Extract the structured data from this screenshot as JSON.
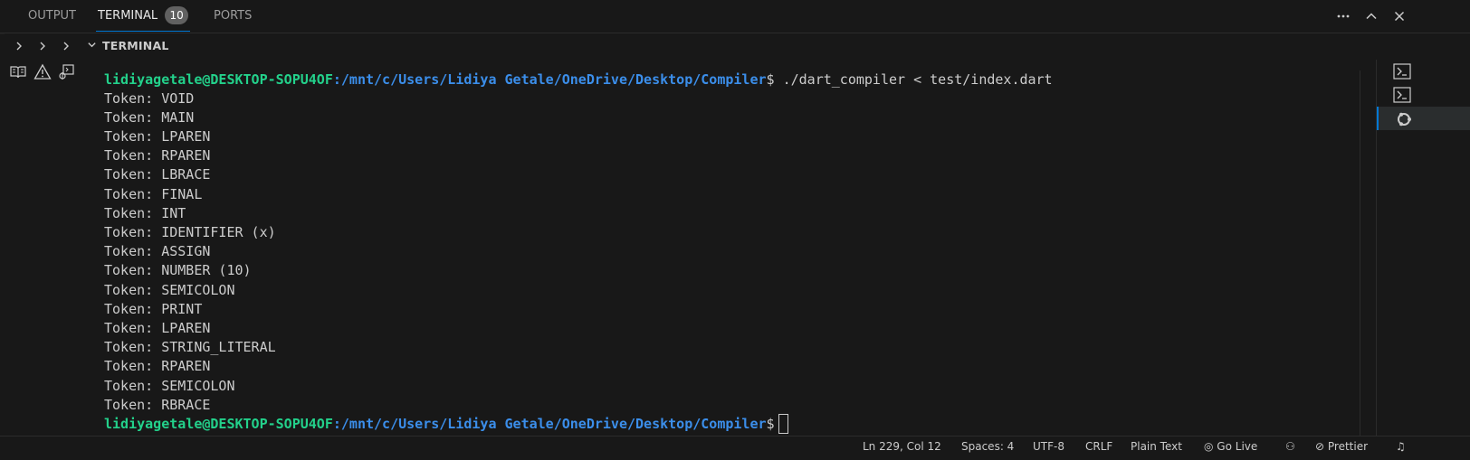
{
  "panel": {
    "tabs": [
      {
        "label": "OUTPUT"
      },
      {
        "label": "TERMINAL",
        "badge": "10"
      },
      {
        "label": "PORTS"
      }
    ],
    "actions": [
      "more-actions-icon",
      "maximize-panel-icon",
      "close-panel-icon"
    ]
  },
  "section": {
    "title": "TERMINAL"
  },
  "terminal": {
    "prompt": {
      "user": "lidiyagetale@DESKTOP-SOPU4OF",
      "path": ":/mnt/c/Users/Lidiya Getale/OneDrive/Desktop/Compiler",
      "dollar": "$"
    },
    "command": " ./dart_compiler < test/index.dart",
    "output": [
      "Token: VOID",
      "Token: MAIN",
      "Token: LPAREN",
      "Token: RPAREN",
      "Token: LBRACE",
      "Token: FINAL",
      "Token: INT",
      "Token: IDENTIFIER (x)",
      "Token: ASSIGN",
      "Token: NUMBER (10)",
      "Token: SEMICOLON",
      "Token: PRINT",
      "Token: LPAREN",
      "Token: STRING_LITERAL",
      "Token: RPAREN",
      "Token: SEMICOLON",
      "Token: RBRACE"
    ]
  },
  "statusbar": {
    "items": [
      "Ln 229, Col 12",
      "Spaces: 4",
      "UTF-8",
      "CRLF",
      "Plain Text",
      "Go Live",
      "Prettier"
    ]
  },
  "colors": {
    "accent": "#0078d4",
    "prompt_user": "#23d18b",
    "prompt_path": "#3b8eea",
    "background": "#181818"
  }
}
